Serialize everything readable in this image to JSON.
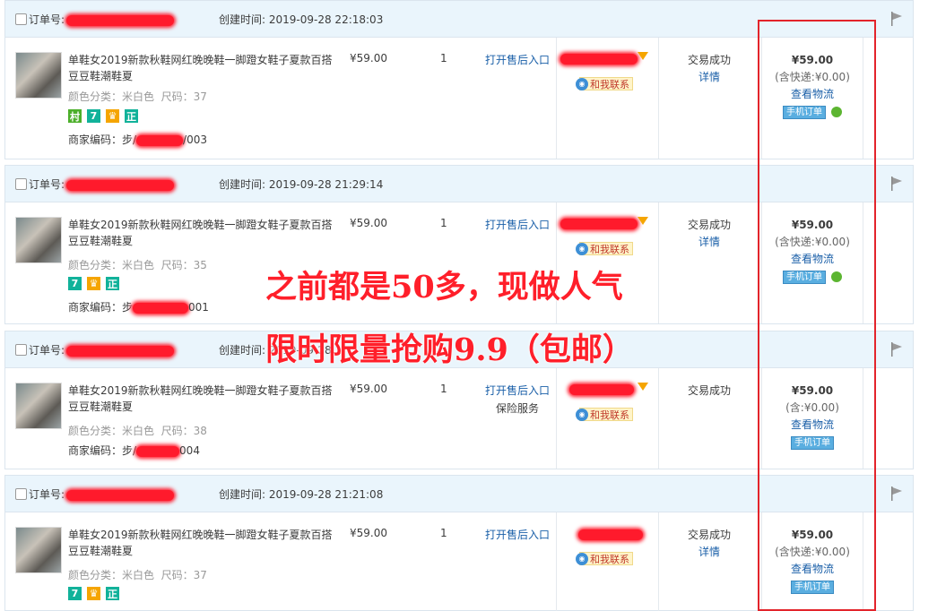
{
  "orders": [
    {
      "order_label": "订单号:",
      "created_label": "创建时间:",
      "created_time": "2019-09-28 22:18:03",
      "product_name": "单鞋女2019新款秋鞋网红晚晚鞋一脚蹬女鞋子夏款百搭豆豆鞋潮鞋夏",
      "color_label": "颜色分类：米白色",
      "size_label": "尺码：37",
      "merchant_code_label": "商家编码：步/",
      "merchant_code_suffix": "/003",
      "price": "¥59.00",
      "qty": "1",
      "aftersale": "打开售后入口",
      "insure": "",
      "contact": "和我联系",
      "status": "交易成功",
      "detail": "详情",
      "total": "¥59.00",
      "shipping": "(含快递:¥0.00)",
      "logistics": "查看物流",
      "mobile_order": "手机订单",
      "badges": [
        "村",
        "7",
        "金",
        "正"
      ]
    },
    {
      "order_label": "订单号:",
      "created_label": "创建时间:",
      "created_time": "2019-09-28 21:29:14",
      "product_name": "单鞋女2019新款秋鞋网红晚晚鞋一脚蹬女鞋子夏款百搭豆豆鞋潮鞋夏",
      "color_label": "颜色分类：米白色",
      "size_label": "尺码：35",
      "merchant_code_label": "商家编码：步",
      "merchant_code_suffix": "001",
      "price": "¥59.00",
      "qty": "1",
      "aftersale": "打开售后入口",
      "insure": "",
      "contact": "和我联系",
      "status": "交易成功",
      "detail": "详情",
      "total": "¥59.00",
      "shipping": "(含快递:¥0.00)",
      "logistics": "查看物流",
      "mobile_order": "手机订单",
      "badges": [
        "7",
        "金",
        "正"
      ]
    },
    {
      "order_label": "订单号:",
      "created_label": "创建时间:",
      "created_time": "2019-09-28 1",
      "product_name": "单鞋女2019新款秋鞋网红晚晚鞋一脚蹬女鞋子夏款百搭豆豆鞋潮鞋夏",
      "color_label": "颜色分类：米白色",
      "size_label": "尺码：38",
      "merchant_code_label": "商家编码：步/",
      "merchant_code_suffix": "004",
      "price": "¥59.00",
      "qty": "1",
      "aftersale": "打开售后入口",
      "insure": "保险服务",
      "contact": "和我联系",
      "status": "交易成功",
      "detail": "",
      "total": "¥59.00",
      "shipping": "(含:¥0.00)",
      "logistics": "查看物流",
      "mobile_order": "手机订单",
      "badges": [
        "7",
        "金",
        "正"
      ]
    },
    {
      "order_label": "订单号:",
      "created_label": "创建时间:",
      "created_time": "2019-09-28 21:21:08",
      "product_name": "单鞋女2019新款秋鞋网红晚晚鞋一脚蹬女鞋子夏款百搭豆豆鞋潮鞋夏",
      "color_label": "颜色分类：米白色",
      "size_label": "尺码：37",
      "merchant_code_label": "",
      "merchant_code_suffix": "",
      "price": "¥59.00",
      "qty": "1",
      "aftersale": "打开售后入口",
      "insure": "",
      "contact": "和我联系",
      "status": "交易成功",
      "detail": "详情",
      "total": "¥59.00",
      "shipping": "(含快递:¥0.00)",
      "logistics": "查看物流",
      "mobile_order": "手机订单",
      "badges": [
        "7",
        "金",
        "正"
      ]
    }
  ],
  "overlay": {
    "line1": "之前都是50多，现做人气",
    "line2": "限时限量抢购9.9（包邮）"
  },
  "colors": {
    "header_bg": "#eaf5fc",
    "link": "#1a5fa8",
    "highlight_red": "#e3242b"
  }
}
